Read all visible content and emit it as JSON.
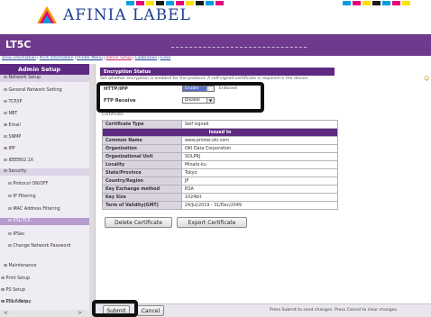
{
  "brand": {
    "logo_text": "AFINIA LABEL",
    "cmyk_colors": [
      "#00a0e0",
      "#e6007e",
      "#ffe100",
      "#1a1a1a"
    ]
  },
  "header": {
    "title": "LT5C"
  },
  "top_links": [
    "View information",
    "Print Information",
    "Printer Menu",
    "Admin Setup",
    "Calibration",
    "Links"
  ],
  "sidebar": {
    "header": "Admin Setup",
    "items": [
      {
        "label": "⊟ Network Setup"
      },
      {
        "label": "⊟ General Network Setting"
      },
      {
        "label": "⊟ TCP/IP"
      },
      {
        "label": "⊟ NBT"
      },
      {
        "label": "⊞ Email"
      },
      {
        "label": "⊟ SNMP"
      },
      {
        "label": "⊞ IPP"
      },
      {
        "label": "⊟ IEEE802.1X"
      },
      {
        "label": "⊟ Security"
      },
      {
        "label": "⊟ Protocol ON/OFF"
      },
      {
        "label": "⊟ IP Filtering"
      },
      {
        "label": "⊟ MAC Address Filtering"
      },
      {
        "label": "⊟ SSL/TLS"
      },
      {
        "label": "⊟ IPSec"
      },
      {
        "label": "⊟ Change Network Password"
      },
      {
        "label": "⊞ Maintenance"
      },
      {
        "label": "⊞ Print Setup"
      },
      {
        "label": "⊞ PS Setup"
      },
      {
        "label": "⊞ PCL Setup"
      },
      {
        "label": "⊞ Color Setup"
      }
    ],
    "scroll_left": "<",
    "scroll_right": ">"
  },
  "main": {
    "section_title": "Encryption Status",
    "help_text": "Set whether encryption is enabled for the protocol. A self-signed certificate is required in the device.",
    "help_icon": "☺",
    "http_label": "HTTP/IPP",
    "http_value": "Enable",
    "http_note": "Enforced",
    "ftp_label": "FTP Receive",
    "ftp_value": "Disable",
    "cert_sub": "Certificate",
    "cert_type_label": "Certificate Type",
    "cert_type_value": "Self signed",
    "issued_to": "Issued to",
    "cert_rows": [
      {
        "k": "Common Name",
        "v": "www.printer.oki.com"
      },
      {
        "k": "Organization",
        "v": "OKI Data Corporation"
      },
      {
        "k": "Organizational Unit",
        "v": "SOLPRJ"
      },
      {
        "k": "Locality",
        "v": "Minato-ku"
      },
      {
        "k": "State/Province",
        "v": "Tokyo"
      },
      {
        "k": "Country/Region",
        "v": "JP"
      },
      {
        "k": "Key Exchange method",
        "v": "RSA"
      },
      {
        "k": "Key Size",
        "v": "1024bit"
      },
      {
        "k": "Term of Validity(GMT)",
        "v": "24/Jul/2019 - 31/Dec/2049"
      }
    ],
    "delete_cert": "Delete Certificate",
    "export_cert": "Export Certificate"
  },
  "footer": {
    "submit": "Submit",
    "cancel": "Cancel",
    "note": "Press Submit to send changes. Press Cancel to clear changes."
  },
  "colors": {
    "accent": "#5e2a81",
    "title_bar": "#6f3a8e",
    "callout": "#111111"
  }
}
